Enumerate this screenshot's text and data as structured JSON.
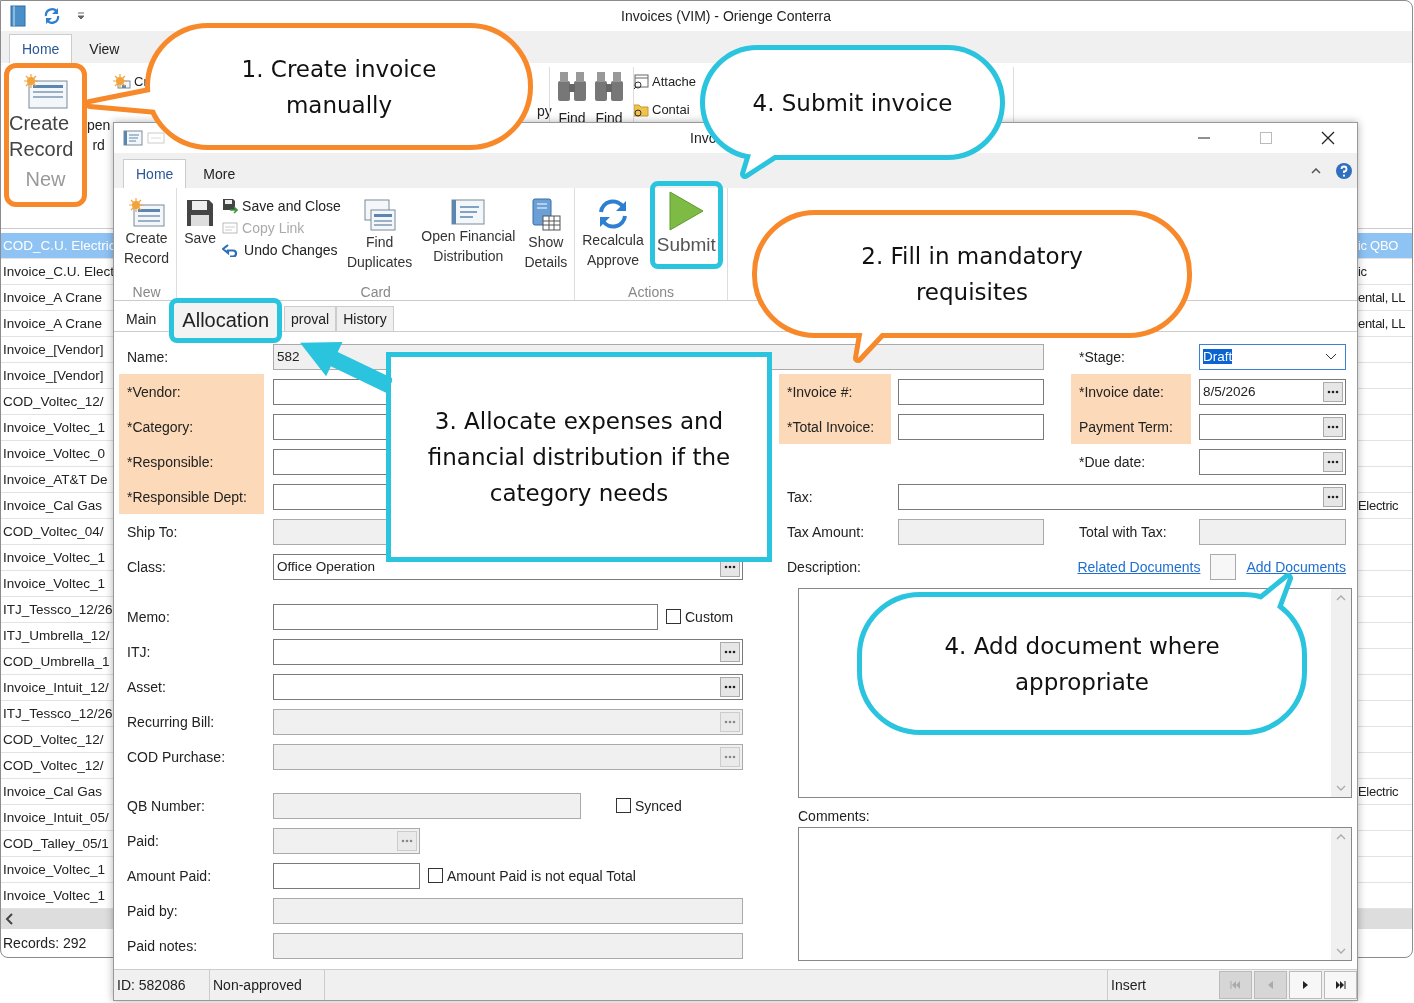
{
  "background_window": {
    "title": "Invoices (VIM) - Orienge Conterra",
    "tabs": [
      {
        "label": "Home",
        "selected": true
      },
      {
        "label": "View",
        "selected": false
      }
    ],
    "ribbon": [
      {
        "kind": "large",
        "label": "Create Record",
        "group": "New",
        "color": "#f7892a"
      },
      {
        "kind": "cut",
        "lines": [
          "pen",
          "rd"
        ]
      },
      {
        "kind": "stack",
        "labels": [
          "Cr"
        ]
      },
      {
        "kind": "cut",
        "lines": [
          "py"
        ]
      },
      {
        "kind": "large",
        "label": "Find"
      },
      {
        "kind": "large",
        "label": "Find"
      },
      {
        "kind": "stack",
        "labels": [
          "Attache",
          "Contai"
        ]
      }
    ],
    "rows": [
      {
        "name": "COD_C.U. Electric",
        "column_2": "ic QBO",
        "selected": true
      },
      {
        "name": "Invoice_C.U. Elect",
        "column_2": "ic",
        "selected": false
      },
      {
        "name": "Invoice_A Crane",
        "column_2": "ental, LL",
        "selected": false
      },
      {
        "name": "Invoice_A Crane",
        "column_2": "ental, LL",
        "selected": false
      },
      {
        "name": "Invoice_[Vendor]",
        "selected": false
      },
      {
        "name": "Invoice_[Vendor]",
        "selected": false
      },
      {
        "name": "COD_Voltec_12/",
        "selected": false
      },
      {
        "name": "Invoice_Voltec_1",
        "selected": false
      },
      {
        "name": "Invoice_Voltec_0",
        "selected": false
      },
      {
        "name": "Invoice_AT&T De",
        "selected": false
      },
      {
        "name": "Invoice_Cal Gas",
        "column_2": "Electric",
        "selected": false
      },
      {
        "name": "COD_Voltec_04/",
        "selected": false
      },
      {
        "name": "Invoice_Voltec_1",
        "selected": false
      },
      {
        "name": "Invoice_Voltec_1",
        "selected": false
      },
      {
        "name": "ITJ_Tessco_12/26",
        "selected": false
      },
      {
        "name": "ITJ_Umbrella_12/",
        "selected": false
      },
      {
        "name": "COD_Umbrella_1",
        "selected": false
      },
      {
        "name": "Invoice_Intuit_12/",
        "selected": false
      },
      {
        "name": "ITJ_Tessco_12/26",
        "selected": false
      },
      {
        "name": "COD_Voltec_12/",
        "selected": false
      },
      {
        "name": "COD_Voltec_12/",
        "selected": false
      },
      {
        "name": "Invoice_Cal Gas",
        "column_2": "Electric",
        "selected": false
      },
      {
        "name": "Invoice_Intuit_05/",
        "selected": false
      },
      {
        "name": "COD_Talley_05/1",
        "selected": false
      },
      {
        "name": "Invoice_Voltec_1",
        "selected": false
      },
      {
        "name": "Invoice_Voltec_1",
        "selected": false
      }
    ],
    "status": "Records: 292"
  },
  "dialog": {
    "title": "Invo",
    "tabs": [
      {
        "label": "Home",
        "selected": true
      },
      {
        "label": "More",
        "selected": false
      }
    ],
    "ribbon_groups": [
      {
        "label": "New",
        "items": [
          {
            "kind": "large",
            "lines": [
              "Create",
              "Record"
            ]
          }
        ]
      },
      {
        "label": "Card",
        "items": [
          {
            "kind": "large",
            "lines": [
              "Save"
            ]
          },
          {
            "kind": "stack",
            "buttons": [
              {
                "label": "Save and Close",
                "disabled": false
              },
              {
                "label": "Copy Link",
                "disabled": true
              },
              {
                "label": "Undo Changes",
                "disabled": false
              }
            ]
          },
          {
            "kind": "large",
            "lines": [
              "Find",
              "Duplicates"
            ]
          },
          {
            "kind": "large",
            "lines": [
              "Open Financial",
              "Distribution"
            ]
          },
          {
            "kind": "large",
            "lines": [
              "Show",
              "Details"
            ]
          }
        ]
      },
      {
        "label": "Actions",
        "items": [
          {
            "kind": "large",
            "lines": [
              "Recalcula",
              "Approve"
            ]
          },
          {
            "kind": "large",
            "lines": [
              "Submit"
            ],
            "color": "#2ac4df"
          }
        ]
      }
    ],
    "form_tabs": [
      {
        "label": "Main",
        "selected": true
      },
      {
        "label": "Allocation",
        "selected": false,
        "color": "#2ac4df"
      },
      {
        "label": "proval",
        "selected": false
      },
      {
        "label": "History",
        "selected": false
      }
    ],
    "fields": [
      {
        "label": "Name:",
        "kind": "readonly",
        "value": "582",
        "highlighted": false
      },
      {
        "label": "*Stage:",
        "kind": "dropdown",
        "value": "Draft",
        "highlighted": false,
        "focused": true
      },
      {
        "label": "*Vendor:",
        "kind": "text",
        "highlighted": true
      },
      {
        "label": "*Invoice #:",
        "kind": "text",
        "highlighted": true
      },
      {
        "label": "*Invoice date:",
        "kind": "lookup",
        "value": "8/5/2026",
        "highlighted": true
      },
      {
        "label": "*Category:",
        "kind": "text",
        "highlighted": true
      },
      {
        "label": "*Total Invoice:",
        "kind": "text",
        "highlighted": true
      },
      {
        "label": "Payment Term:",
        "kind": "lookup",
        "highlighted": true
      },
      {
        "label": "*Responsible:",
        "kind": "text",
        "highlighted": true
      },
      {
        "label": "*Due date:",
        "kind": "lookup",
        "highlighted": false
      },
      {
        "label": "*Responsible Dept:",
        "kind": "text",
        "highlighted": true
      },
      {
        "label": "Tax:",
        "kind": "lookup",
        "highlighted": false
      },
      {
        "label": "Ship To:",
        "kind": "readonly",
        "highlighted": false
      },
      {
        "label": "Tax Amount:",
        "kind": "readonly",
        "highlighted": false
      },
      {
        "label": "Total with Tax:",
        "kind": "readonly",
        "highlighted": false
      },
      {
        "label": "Class:",
        "kind": "lookup",
        "value": "Office Operation",
        "highlighted": false
      }
    ],
    "description": {
      "label": "Description:",
      "links": [
        "Related Documents",
        "Add Documents"
      ]
    },
    "lower_fields": [
      {
        "label": "Memo:",
        "kind": "text",
        "checkbox": {
          "label": "Custom",
          "checked": false
        }
      },
      {
        "label": "ITJ:",
        "kind": "lookup"
      },
      {
        "label": "Asset:",
        "kind": "lookup"
      },
      {
        "label": "Recurring Bill:",
        "kind": "readonly-lookup"
      },
      {
        "label": "COD Purchase:",
        "kind": "readonly-lookup"
      },
      {
        "label": "QB Number:",
        "kind": "readonly",
        "checkbox": {
          "label": "Synced",
          "checked": false
        }
      },
      {
        "label": "Paid:",
        "kind": "readonly-lookup"
      },
      {
        "label": "Amount Paid:",
        "kind": "text",
        "checkbox": {
          "label": "Amount Paid is not equal Total",
          "checked": false
        }
      },
      {
        "label": "Paid by:",
        "kind": "readonly"
      },
      {
        "label": "Paid notes:",
        "kind": "readonly"
      }
    ],
    "comments_label": "Comments:",
    "status_bar": {
      "id": "ID: 582086",
      "state": "Non-approved",
      "mode": "Insert",
      "nav": [
        {
          "kind": "first",
          "disabled": true
        },
        {
          "kind": "prev",
          "disabled": true
        },
        {
          "kind": "next",
          "disabled": false
        },
        {
          "kind": "last",
          "disabled": false
        }
      ]
    }
  },
  "callouts": [
    {
      "kind": "bubble",
      "text": "1. Create invoice\nmanually",
      "color": "#f7892a"
    },
    {
      "kind": "bubble",
      "text": "4. Submit invoice",
      "color": "#2ac4df"
    },
    {
      "kind": "bubble",
      "text": "2. Fill in mandatory\nrequisites",
      "color": "#f7892a"
    },
    {
      "kind": "box",
      "text": "3. Allocate expenses and\nfinancial distribution if the\ncategory needs",
      "color": "#2ac4df"
    },
    {
      "kind": "bubble",
      "text": "4. Add document where\nappropriate",
      "color": "#2ac4df"
    }
  ]
}
